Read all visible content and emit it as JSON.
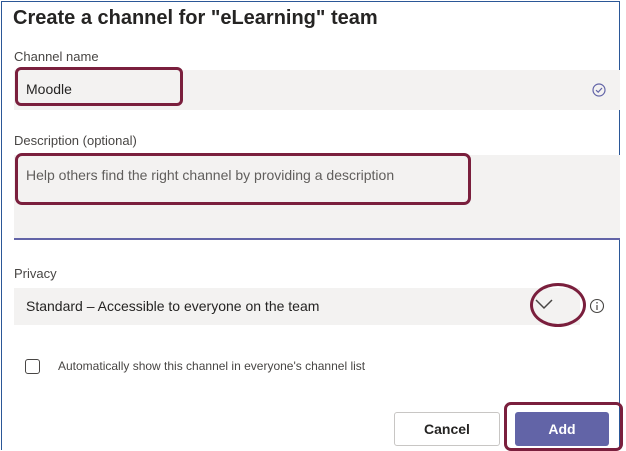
{
  "dialog": {
    "title": "Create a channel for \"eLearning\" team"
  },
  "channel_name": {
    "label": "Channel name",
    "value": "Moodle",
    "status_icon": "check-circle-icon"
  },
  "description": {
    "label": "Description (optional)",
    "placeholder": "Help others find the right channel by providing a description"
  },
  "privacy": {
    "label": "Privacy",
    "selected": "Standard – Accessible to everyone on the team",
    "dropdown_icon": "chevron-down-icon",
    "info_icon": "info-icon"
  },
  "auto_show": {
    "label": "Automatically show this channel in everyone's channel list",
    "checked": false
  },
  "buttons": {
    "cancel": "Cancel",
    "add": "Add"
  },
  "colors": {
    "accent": "#6264a7",
    "field_bg": "#f3f2f1",
    "highlight": "#7a1f3d"
  }
}
